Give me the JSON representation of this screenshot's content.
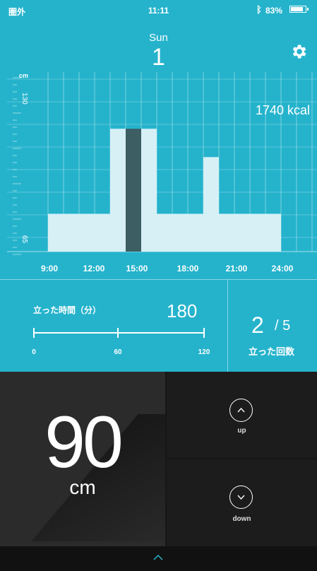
{
  "status_bar": {
    "carrier": "圏外",
    "time": "11:11",
    "bluetooth_icon": "bluetooth-icon",
    "battery_text": "83%",
    "battery_level": 0.83
  },
  "header": {
    "day_name": "Sun",
    "day_number": "1",
    "settings_icon": "gear-icon"
  },
  "chart_data": {
    "type": "bar",
    "ylabel": "cm",
    "y_ticks": [
      "130",
      "65"
    ],
    "x_ticks": [
      "9:00",
      "12:00",
      "15:00",
      "18:00",
      "21:00",
      "24:00"
    ],
    "annotation": "1740 kcal",
    "bars": [
      {
        "start": "8:00",
        "end": "12:00",
        "value": 65
      },
      {
        "start": "12:00",
        "end": "13:00",
        "value": 110
      },
      {
        "start": "13:00",
        "end": "14:00",
        "value": 110,
        "highlight": true
      },
      {
        "start": "14:00",
        "end": "15:00",
        "value": 110
      },
      {
        "start": "15:00",
        "end": "18:00",
        "value": 65
      },
      {
        "start": "18:00",
        "end": "19:00",
        "value": 95
      },
      {
        "start": "19:00",
        "end": "23:00",
        "value": 65
      }
    ],
    "colors": {
      "bar": "#d6f0f6",
      "highlight": "#3d5e63",
      "background": "#25b3cc"
    }
  },
  "stats": {
    "standing_time_label": "立った時間（分）",
    "standing_time_value": "180",
    "standing_scale": [
      "0",
      "60",
      "120"
    ],
    "stand_count_current": "2",
    "stand_count_separator": "/ 5",
    "stand_count_label": "立った回数"
  },
  "control": {
    "height_value": "90",
    "height_unit": "cm",
    "up_label": "up",
    "down_label": "down"
  },
  "colors": {
    "accent": "#25b3cc",
    "dark_panel": "#2b2b2b",
    "button_panel": "#1c1c1c"
  }
}
